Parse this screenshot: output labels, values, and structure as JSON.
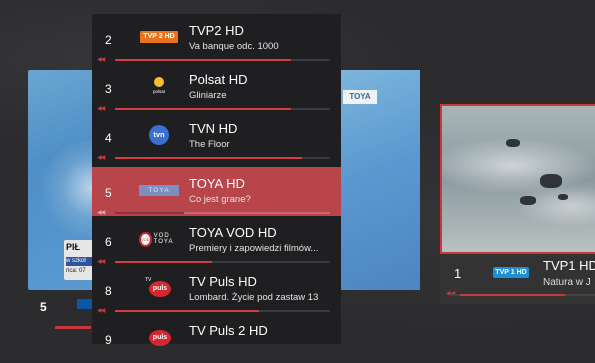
{
  "colors": {
    "accent": "#c8383e",
    "panel": "#1f1f21",
    "background": "#2c2c2e"
  },
  "left_preview": {
    "news_headline": "PIŁ",
    "news_ticker": "w szkoł",
    "news_time": "rica: 07",
    "channel_number": "5"
  },
  "right_preview": {
    "channel_number": "1",
    "logo_text": "TVP 1 HD",
    "title": "TVP1 HD",
    "subtitle": "Natura w J"
  },
  "middle_preview": {
    "logo_text": "TOYA"
  },
  "channels": [
    {
      "num": "2",
      "logo": "tvp2-logo",
      "logo_text": "TVP 2 HD",
      "title": "TVP2 HD",
      "subtitle": "Va banque odc. 1000",
      "progress": 0.82,
      "active": false
    },
    {
      "num": "3",
      "logo": "polsat-logo",
      "logo_text": "polsat",
      "title": "Polsat HD",
      "subtitle": "Gliniarze",
      "progress": 0.82,
      "active": false
    },
    {
      "num": "4",
      "logo": "tvn-logo",
      "logo_text": "tvn",
      "title": "TVN HD",
      "subtitle": "The Floor",
      "progress": 0.87,
      "active": false
    },
    {
      "num": "5",
      "logo": "toya-logo",
      "logo_text": "TOYA",
      "title": "TOYA HD",
      "subtitle": "Co jest grane?",
      "progress": 0.32,
      "active": true
    },
    {
      "num": "6",
      "logo": "toya-vod-logo",
      "logo_text": "VOD TOYA",
      "title": "TOYA VOD HD",
      "subtitle": "Premiery i zapowiedzi filmów...",
      "progress": 0.45,
      "active": false
    },
    {
      "num": "8",
      "logo": "tvpuls-logo",
      "logo_text": "puls",
      "title": "TV Puls HD",
      "subtitle": "Lombard. Życie pod zastaw 13",
      "progress": 0.67,
      "active": false
    },
    {
      "num": "9",
      "logo": "tvpuls2-logo",
      "logo_text": "puls",
      "title": "TV Puls 2 HD",
      "subtitle": "",
      "progress": 0.0,
      "active": false
    }
  ]
}
